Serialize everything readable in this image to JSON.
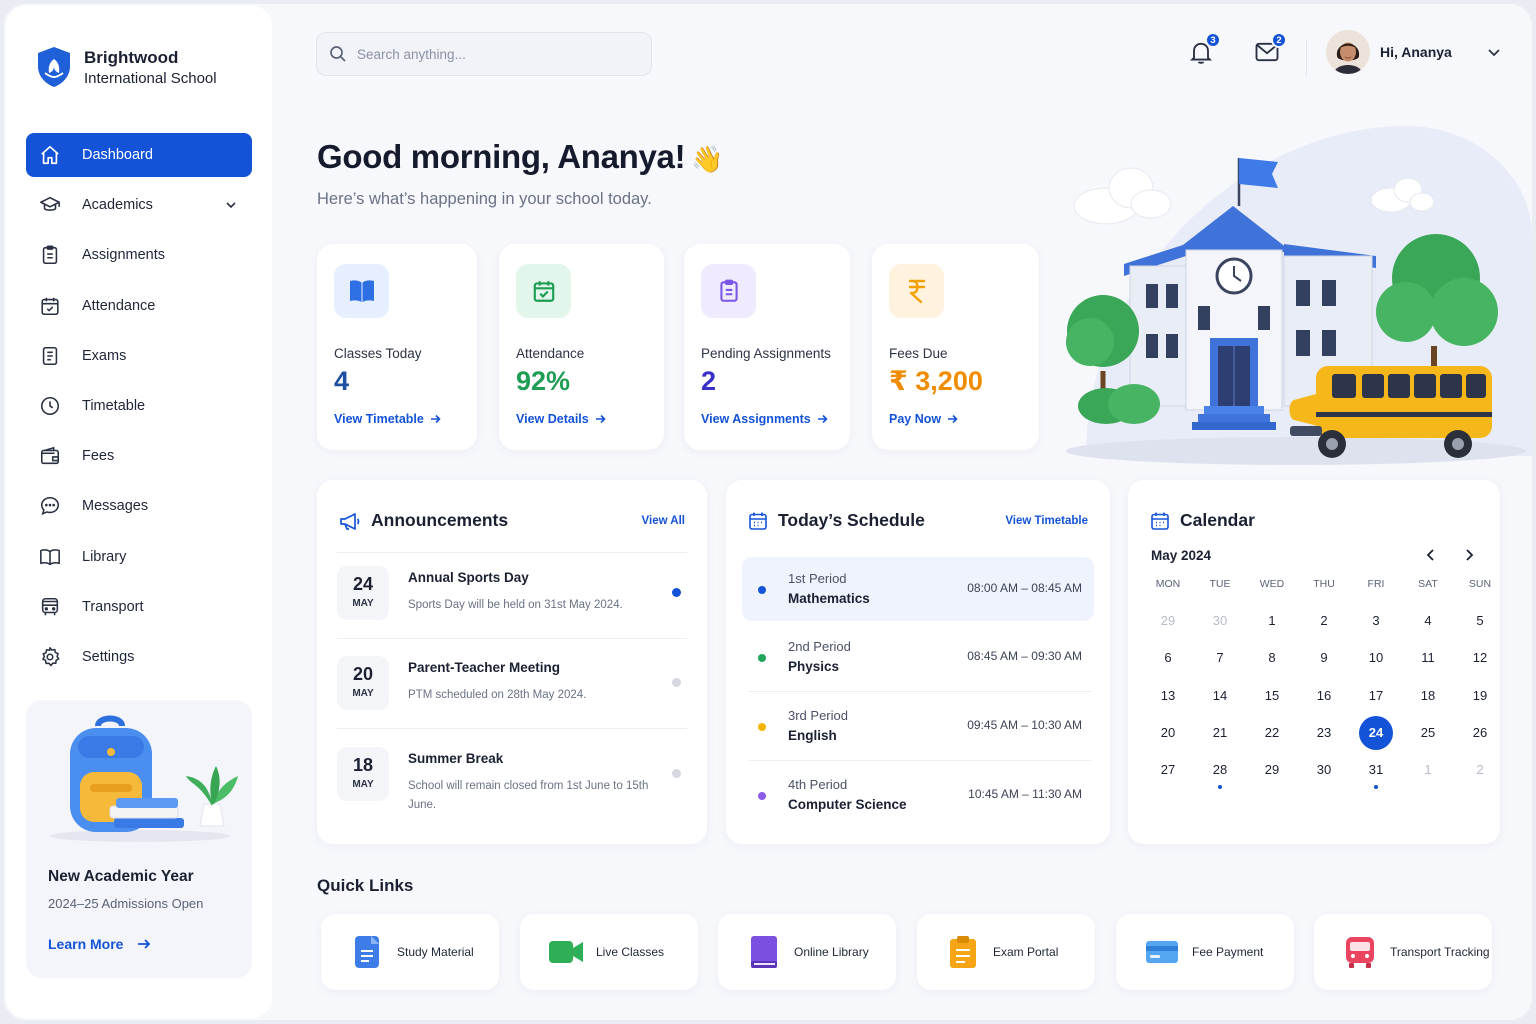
{
  "brand": {
    "name": "Brightwood",
    "subtitle": "International School"
  },
  "nav": {
    "items": [
      {
        "label": "Dashboard",
        "icon": "home-icon",
        "active": true
      },
      {
        "label": "Academics",
        "icon": "graduation-cap-icon",
        "has_submenu": true
      },
      {
        "label": "Assignments",
        "icon": "clipboard-icon"
      },
      {
        "label": "Attendance",
        "icon": "calendar-check-icon"
      },
      {
        "label": "Exams",
        "icon": "document-icon"
      },
      {
        "label": "Timetable",
        "icon": "clock-icon"
      },
      {
        "label": "Fees",
        "icon": "wallet-icon"
      },
      {
        "label": "Messages",
        "icon": "chat-bubble-icon"
      },
      {
        "label": "Library",
        "icon": "open-book-icon"
      },
      {
        "label": "Transport",
        "icon": "bus-icon"
      },
      {
        "label": "Settings",
        "icon": "gear-icon"
      }
    ]
  },
  "promo": {
    "title": "New Academic Year",
    "subtitle": "2024–25 Admissions Open",
    "link": "Learn More"
  },
  "header": {
    "search_placeholder": "Search anything...",
    "notifications_count": "3",
    "messages_count": "2",
    "user_greeting": "Hi, Ananya"
  },
  "greeting": {
    "title": "Good morning, Ananya!",
    "emoji": "👋",
    "subtitle": "Here’s what’s happening in your school today."
  },
  "stats": [
    {
      "label": "Classes Today",
      "value": "4",
      "link": "View Timetable",
      "icon": "book-icon",
      "color": "#1e4fa3",
      "icon_bg": "#e6efff",
      "icon_color": "#2f6fe4"
    },
    {
      "label": "Attendance",
      "value": "92%",
      "link": "View Details",
      "icon": "calendar-check-icon",
      "color": "#1f9d55",
      "icon_bg": "#e3f6ec",
      "icon_color": "#1f9d55"
    },
    {
      "label": "Pending Assignments",
      "value": "2",
      "link": "View Assignments",
      "icon": "clipboard-icon",
      "color": "#3b2fc9",
      "icon_bg": "#efeafd",
      "icon_color": "#7a55e6"
    },
    {
      "label": "Fees Due",
      "value": "₹ 3,200",
      "link": "Pay Now",
      "icon": "rupee-icon",
      "color": "#f08c00",
      "icon_bg": "#fff3df",
      "icon_color": "#f5a000"
    }
  ],
  "announcements": {
    "title": "Announcements",
    "view_all": "View All",
    "items": [
      {
        "day": "24",
        "month": "MAY",
        "title": "Annual Sports Day",
        "desc": "Sports Day will be held on 31st May 2024.",
        "unread": true
      },
      {
        "day": "20",
        "month": "MAY",
        "title": "Parent-Teacher Meeting",
        "desc": "PTM scheduled on 28th May 2024.",
        "unread": false
      },
      {
        "day": "18",
        "month": "MAY",
        "title": "Summer Break",
        "desc": "School will remain closed from 1st June to 15th June.",
        "unread": false
      }
    ]
  },
  "schedule": {
    "title": "Today’s Schedule",
    "view_link": "View Timetable",
    "items": [
      {
        "period": "1st Period",
        "subject": "Mathematics",
        "time": "08:00 AM – 08:45 AM",
        "dot": "#1453d8",
        "current": true
      },
      {
        "period": "2nd Period",
        "subject": "Physics",
        "time": "08:45 AM – 09:30 AM",
        "dot": "#22a55a",
        "current": false
      },
      {
        "period": "3rd Period",
        "subject": "English",
        "time": "09:45 AM – 10:30 AM",
        "dot": "#f5b400",
        "current": false
      },
      {
        "period": "4th Period",
        "subject": "Computer Science",
        "time": "10:45 AM – 11:30 AM",
        "dot": "#8b5ce6",
        "current": false
      }
    ]
  },
  "calendar": {
    "title": "Calendar",
    "month": "May 2024",
    "weekdays": [
      "MON",
      "TUE",
      "WED",
      "THU",
      "FRI",
      "SAT",
      "SUN"
    ],
    "weeks": [
      [
        {
          "d": "29",
          "m": true
        },
        {
          "d": "30",
          "m": true
        },
        {
          "d": "1"
        },
        {
          "d": "2"
        },
        {
          "d": "3"
        },
        {
          "d": "4"
        },
        {
          "d": "5"
        }
      ],
      [
        {
          "d": "6"
        },
        {
          "d": "7"
        },
        {
          "d": "8"
        },
        {
          "d": "9"
        },
        {
          "d": "10"
        },
        {
          "d": "11"
        },
        {
          "d": "12"
        }
      ],
      [
        {
          "d": "13"
        },
        {
          "d": "14"
        },
        {
          "d": "15"
        },
        {
          "d": "16"
        },
        {
          "d": "17"
        },
        {
          "d": "18"
        },
        {
          "d": "19"
        }
      ],
      [
        {
          "d": "20"
        },
        {
          "d": "21"
        },
        {
          "d": "22"
        },
        {
          "d": "23"
        },
        {
          "d": "24",
          "today": true
        },
        {
          "d": "25"
        },
        {
          "d": "26"
        }
      ],
      [
        {
          "d": "27"
        },
        {
          "d": "28",
          "event": true
        },
        {
          "d": "29"
        },
        {
          "d": "30"
        },
        {
          "d": "31",
          "event": true
        },
        {
          "d": "1",
          "m": true
        },
        {
          "d": "2",
          "m": true
        }
      ]
    ]
  },
  "quick_links": {
    "title": "Quick Links",
    "items": [
      {
        "label": "Study Material",
        "icon": "document-icon"
      },
      {
        "label": "Live Classes",
        "icon": "video-camera-icon"
      },
      {
        "label": "Online Library",
        "icon": "book-icon"
      },
      {
        "label": "Exam Portal",
        "icon": "clipboard-icon"
      },
      {
        "label": "Fee Payment",
        "icon": "credit-card-icon"
      },
      {
        "label": "Transport Tracking",
        "icon": "bus-icon"
      }
    ]
  },
  "colors": {
    "primary": "#1453d8",
    "background": "#f7f8fc"
  }
}
